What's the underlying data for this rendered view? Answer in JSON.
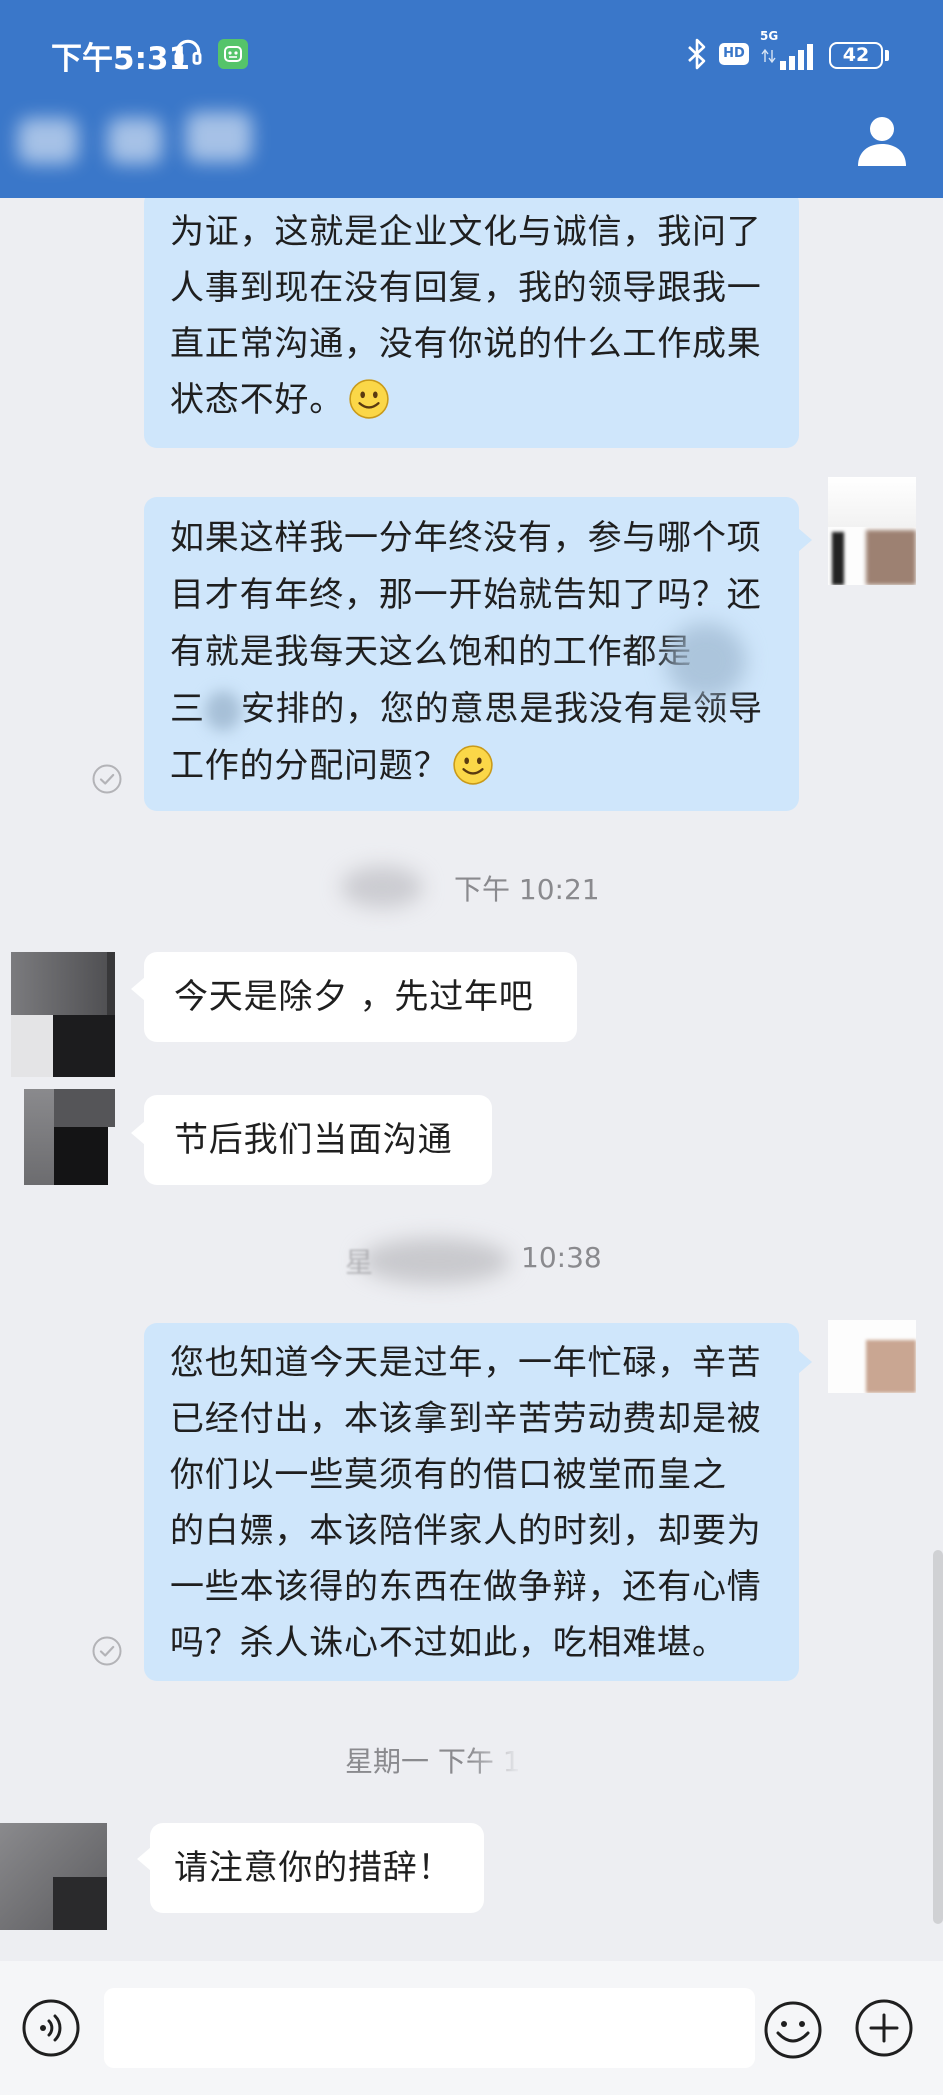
{
  "status_bar": {
    "time": "下午5:31",
    "hd_badge": "HD",
    "network": "5G",
    "battery": "42"
  },
  "chat": {
    "msg1": {
      "lines": [
        "为证，这就是企业文化与诚信，我问了",
        "人事到现在没有回复，我的领导跟我一",
        "直正常沟通，没有你说的什么工作成果",
        "状态不好。"
      ],
      "emoji": "smile-emoji"
    },
    "msg2": {
      "lines": [
        "如果这样我一分年终没有，参与哪个项",
        "目才有年终，那一开始就告知了吗？还",
        "有就是我每天这么饱和的工作都是",
        "安排的，您的意思是我没有是领导",
        "工作的分配问题？"
      ],
      "line4_lead": "三",
      "emoji": "smile-emoji"
    },
    "time1": "下午 10:21",
    "msg3": {
      "text": "今天是除夕 ，先过年吧"
    },
    "msg4": {
      "text": "节后我们当面沟通"
    },
    "time2": {
      "lead": "星",
      "text": "10:38"
    },
    "msg5": {
      "lines": [
        "您也知道今天是过年，一年忙碌，辛苦",
        "已经付出，本该拿到辛苦劳动费却是被",
        "你们以一些莫须有的借口被堂而皇之",
        "的白嫖，本该陪伴家人的时刻，却要为",
        "一些本该得的东西在做争辩，还有心情",
        "吗？杀人诛心不过如此，吃相难堪。"
      ]
    },
    "time3": "星期一 下午 1",
    "msg6": {
      "text": "请注意你的措辞！"
    }
  },
  "icons": {
    "headphone": "headphone-icon",
    "app": "app-notification-icon",
    "bluetooth": "bluetooth-icon",
    "signal": "signal-icon",
    "battery": "battery-icon",
    "contact": "person-icon",
    "read_receipt": "read-check-icon",
    "voice": "voice-icon",
    "emoji": "emoji-icon",
    "plus": "plus-icon"
  },
  "colors": {
    "header": "#3a77c9",
    "background": "#edeef2",
    "bubble_self": "#cfe6fb",
    "bubble_other": "#ffffff",
    "timestamp": "#8a8a8e"
  }
}
